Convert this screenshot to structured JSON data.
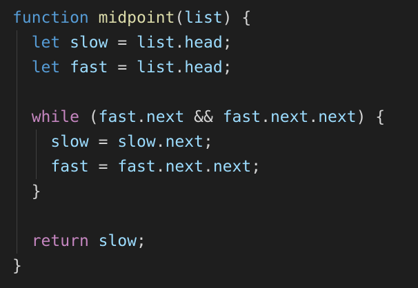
{
  "code": {
    "language": "javascript",
    "lines": [
      {
        "tokens": [
          [
            "kw-blue",
            "function"
          ],
          [
            "op",
            " "
          ],
          [
            "fn",
            "midpoint"
          ],
          [
            "punc",
            "("
          ],
          [
            "var",
            "list"
          ],
          [
            "punc",
            ") {"
          ]
        ]
      },
      {
        "tokens": [
          [
            "op",
            "  "
          ],
          [
            "kw-blue",
            "let"
          ],
          [
            "op",
            " "
          ],
          [
            "var",
            "slow"
          ],
          [
            "op",
            " = "
          ],
          [
            "var",
            "list"
          ],
          [
            "punc",
            "."
          ],
          [
            "prop",
            "head"
          ],
          [
            "punc",
            ";"
          ]
        ]
      },
      {
        "tokens": [
          [
            "op",
            "  "
          ],
          [
            "kw-blue",
            "let"
          ],
          [
            "op",
            " "
          ],
          [
            "var",
            "fast"
          ],
          [
            "op",
            " = "
          ],
          [
            "var",
            "list"
          ],
          [
            "punc",
            "."
          ],
          [
            "prop",
            "head"
          ],
          [
            "punc",
            ";"
          ]
        ]
      },
      {
        "tokens": []
      },
      {
        "tokens": [
          [
            "op",
            "  "
          ],
          [
            "kw-purple",
            "while"
          ],
          [
            "op",
            " ("
          ],
          [
            "var",
            "fast"
          ],
          [
            "punc",
            "."
          ],
          [
            "prop",
            "next"
          ],
          [
            "op",
            " && "
          ],
          [
            "var",
            "fast"
          ],
          [
            "punc",
            "."
          ],
          [
            "prop",
            "next"
          ],
          [
            "punc",
            "."
          ],
          [
            "prop",
            "next"
          ],
          [
            "punc",
            ") {"
          ]
        ]
      },
      {
        "tokens": [
          [
            "op",
            "    "
          ],
          [
            "var",
            "slow"
          ],
          [
            "op",
            " = "
          ],
          [
            "var",
            "slow"
          ],
          [
            "punc",
            "."
          ],
          [
            "prop",
            "next"
          ],
          [
            "punc",
            ";"
          ]
        ]
      },
      {
        "tokens": [
          [
            "op",
            "    "
          ],
          [
            "var",
            "fast"
          ],
          [
            "op",
            " = "
          ],
          [
            "var",
            "fast"
          ],
          [
            "punc",
            "."
          ],
          [
            "prop",
            "next"
          ],
          [
            "punc",
            "."
          ],
          [
            "prop",
            "next"
          ],
          [
            "punc",
            ";"
          ]
        ]
      },
      {
        "tokens": [
          [
            "op",
            "  "
          ],
          [
            "punc",
            "}"
          ]
        ]
      },
      {
        "tokens": []
      },
      {
        "tokens": [
          [
            "op",
            "  "
          ],
          [
            "kw-purple",
            "return"
          ],
          [
            "op",
            " "
          ],
          [
            "var",
            "slow"
          ],
          [
            "punc",
            ";"
          ]
        ]
      },
      {
        "tokens": [
          [
            "punc",
            "}"
          ]
        ]
      }
    ]
  },
  "colors": {
    "background": "#1e1e1e",
    "keyword_declaration": "#569cd6",
    "keyword_control": "#c586c0",
    "function_name": "#dcdcaa",
    "variable": "#9cdcfe",
    "punctuation": "#d4d4d4",
    "indent_guide": "#404040"
  }
}
